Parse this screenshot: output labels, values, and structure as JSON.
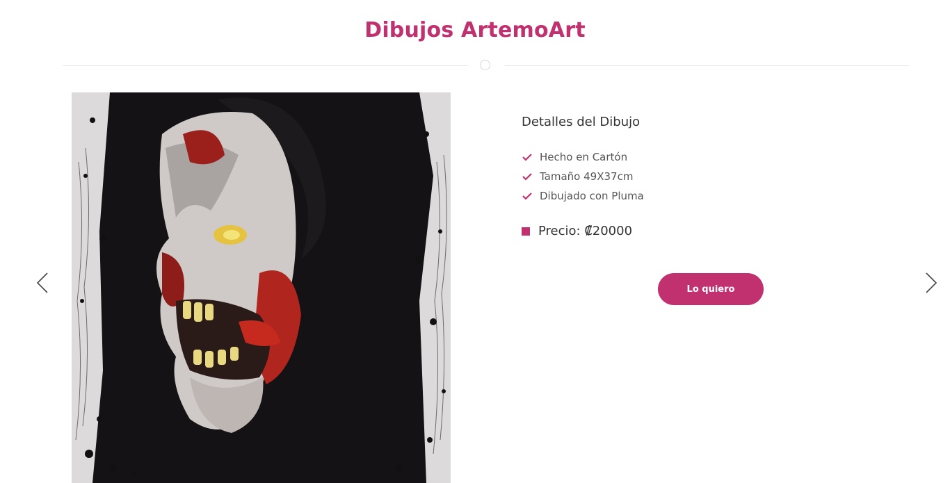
{
  "header": {
    "title": "Dibujos ArtemoArt"
  },
  "carousel": {
    "prev_icon": "chevron-left-icon",
    "next_icon": "chevron-right-icon"
  },
  "artwork": {
    "subject": "zombie-skull-drawing-image"
  },
  "details": {
    "heading": "Detalles del Dibujo",
    "features": [
      {
        "icon": "check-icon",
        "label": "Hecho en Cartón"
      },
      {
        "icon": "check-icon",
        "label": "Tamaño 49X37cm"
      },
      {
        "icon": "check-icon",
        "label": "Dibujado con Pluma"
      }
    ],
    "price": {
      "icon": "square-icon",
      "label": "Precio: ₡20000"
    },
    "button_label": "Lo quiero"
  },
  "colors": {
    "accent": "#c1306f",
    "text": "#333333",
    "muted": "#555555",
    "divider": "#e8e8e8"
  }
}
